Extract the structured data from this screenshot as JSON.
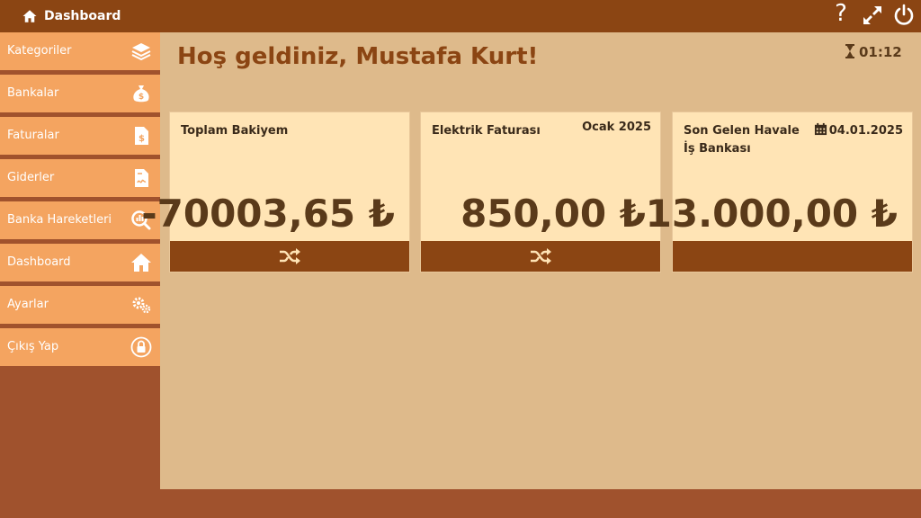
{
  "header": {
    "title": "Dashboard",
    "help_glyph": "?"
  },
  "sidebar": {
    "items": [
      {
        "label": "Kategoriler",
        "icon": "layers-icon"
      },
      {
        "label": "Bankalar",
        "icon": "money-bag-icon"
      },
      {
        "label": "Faturalar",
        "icon": "invoice-icon"
      },
      {
        "label": "Giderler",
        "icon": "receipt-icon"
      },
      {
        "label": "Banka Hareketleri",
        "icon": "chart-search-icon"
      },
      {
        "label": "Dashboard",
        "icon": "home-icon"
      },
      {
        "label": "Ayarlar",
        "icon": "gears-icon"
      },
      {
        "label": "Çıkış Yap",
        "icon": "lock-icon"
      }
    ]
  },
  "main": {
    "welcome": "Hoş geldiniz, Mustafa Kurt!",
    "timer": "01:12"
  },
  "cards": [
    {
      "title": "Toplam Bakiyem",
      "amount": "-70003,65 ₺"
    },
    {
      "title": "Elektrik Faturası",
      "period": "Ocak 2025",
      "amount": "850,00 ₺"
    },
    {
      "title": "Son Gelen Havale",
      "subtitle": "İş Bankası",
      "date": "04.01.2025",
      "amount": "13.000,00 ₺"
    }
  ],
  "colors": {
    "header": "#8B4513",
    "sidebar_item": "#F4A460",
    "sidebar_bg": "#A0522D",
    "content_bg": "#DEBA8B",
    "card_bg": "#FFE4B5",
    "accent_text": "#8B4513"
  }
}
